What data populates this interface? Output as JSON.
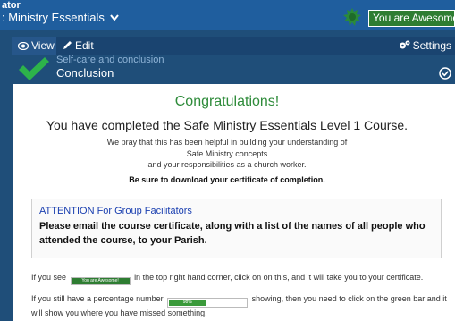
{
  "header": {
    "brand_small": "ator",
    "course_title": ": Ministry Essentials",
    "awesome_label": "You are Awesome!",
    "accent": "#2e7d32"
  },
  "tabs": {
    "view": "View",
    "edit": "Edit",
    "settings": "Settings"
  },
  "lesson": {
    "module": "Self-care and conclusion",
    "title": "Conclusion",
    "check_color": "#2db34a"
  },
  "content": {
    "congrats": "Congratulations!",
    "completed": "You have completed the Safe Ministry Essentials Level 1 Course.",
    "pray_lines": [
      "We pray that this has been helpful in building your understanding of",
      "Safe Ministry concepts",
      "and your responsibilities as a church worker."
    ],
    "download": "Be sure to download your certificate of completion.",
    "attention_title": "ATTENTION For Group Facilitators",
    "attention_body": "Please email the course certificate, along with a list of the names of all people who attended the course, to your Parish.",
    "p1_before": "If you see",
    "p1_badge": "You are Awesome!",
    "p1_after": "in the top right hand corner, click on on this, and it will take you to your certificate.",
    "p2_before": "If you still have a percentage number",
    "p2_pct": "98%",
    "p2_after": "showing, then you need to click on the green bar and it will show you where you have missed something."
  }
}
